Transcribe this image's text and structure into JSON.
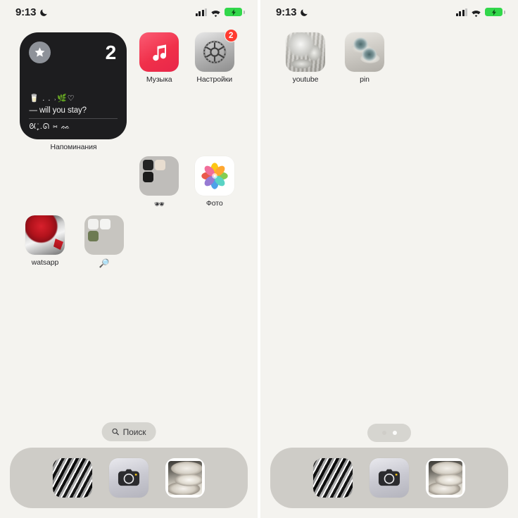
{
  "status_bar": {
    "time": "9:13",
    "dnd_icon": "crescent-moon-icon",
    "signal_icon": "cellular-signal-icon",
    "wifi_icon": "wifi-icon",
    "battery_icon": "battery-charging-icon",
    "battery_color": "#32d74b"
  },
  "theme": {
    "wallpaper": "#f4f3ef",
    "widget_bg": "#1d1d1f",
    "badge_color": "#ff3b30",
    "dock_bg": "rgba(191,189,183,0.72)"
  },
  "page1": {
    "widget": {
      "app_label": "Напоминания",
      "count": "2",
      "list_icon": "star-icon",
      "emoji_row_top": "🥛 . . ˒🌿♡",
      "note": "— will you stay?",
      "emoji_row_bottom": "ᘡ₊̣̇.ᘏ ⑅ ᨐ"
    },
    "apps": [
      {
        "label": "Музыка",
        "icon": "music-app-icon"
      },
      {
        "label": "Настройки",
        "icon": "settings-app-icon",
        "badge": "2"
      },
      {
        "label": "🕶",
        "icon": "folder-icon"
      },
      {
        "label": "Фото",
        "icon": "photos-app-icon"
      },
      {
        "label": "watsapp",
        "icon": "watsapp-photo-icon"
      },
      {
        "label": "🔎",
        "icon": "folder-icon"
      }
    ],
    "search": {
      "label": "Поиск",
      "icon": "search-icon"
    }
  },
  "page2": {
    "apps": [
      {
        "label": "youtube",
        "icon": "youtube-photo-icon"
      },
      {
        "label": "pin",
        "icon": "pin-photo-icon"
      }
    ],
    "page_dots": {
      "count": 2,
      "active_index": 1
    }
  },
  "dock": {
    "items": [
      {
        "label": "abstract-photo-shortcut",
        "icon": "abstract-photo-icon"
      },
      {
        "label": "Камера",
        "icon": "camera-app-icon"
      },
      {
        "label": "plates-photo-shortcut",
        "icon": "plates-photo-icon"
      }
    ]
  }
}
